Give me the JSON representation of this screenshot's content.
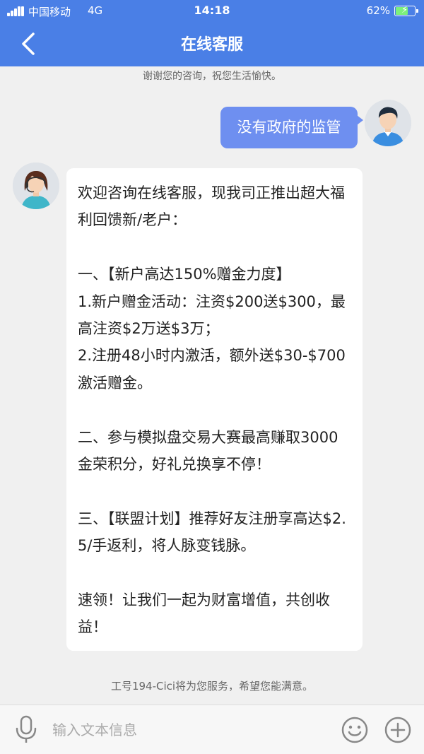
{
  "status_bar": {
    "carrier": "中国移动",
    "network": "4G",
    "time": "14:18",
    "battery": "62%",
    "battery_level": 0.62
  },
  "header": {
    "title": "在线客服",
    "back_icon": "chevron-left-icon"
  },
  "notice_top": "谢谢您的咨询，祝您生活愉快。",
  "messages": {
    "user": {
      "text": "没有政府的监管"
    },
    "agent": {
      "lines": [
        "欢迎咨询在线客服，现我司正推出超大福利回馈新/老户：",
        "",
        "一、【新户高达150%赠金力度】",
        "1.新户赠金活动：注资$200送$300，最高注资$2万送$3万；",
        "2.注册48小时内激活，额外送$30-$700激活赠金。",
        "",
        "二、参与模拟盘交易大赛最高赚取3000金荣积分，好礼兑换享不停！",
        "",
        "三、【联盟计划】推荐好友注册享高达$2.5/手返利，将人脉变钱脉。",
        "",
        "速领！让我们一起为财富增值，共创收益！"
      ]
    }
  },
  "notice_bottom": "工号194-Cici将为您服务，希望您能满意。",
  "input_bar": {
    "placeholder": "输入文本信息",
    "value": "",
    "icons": [
      "microphone-icon",
      "emoji-icon",
      "plus-icon"
    ]
  },
  "colors": {
    "header_blue": "#4a7fe6",
    "user_bubble": "#6e8ff0",
    "background": "#f0f0f0"
  }
}
